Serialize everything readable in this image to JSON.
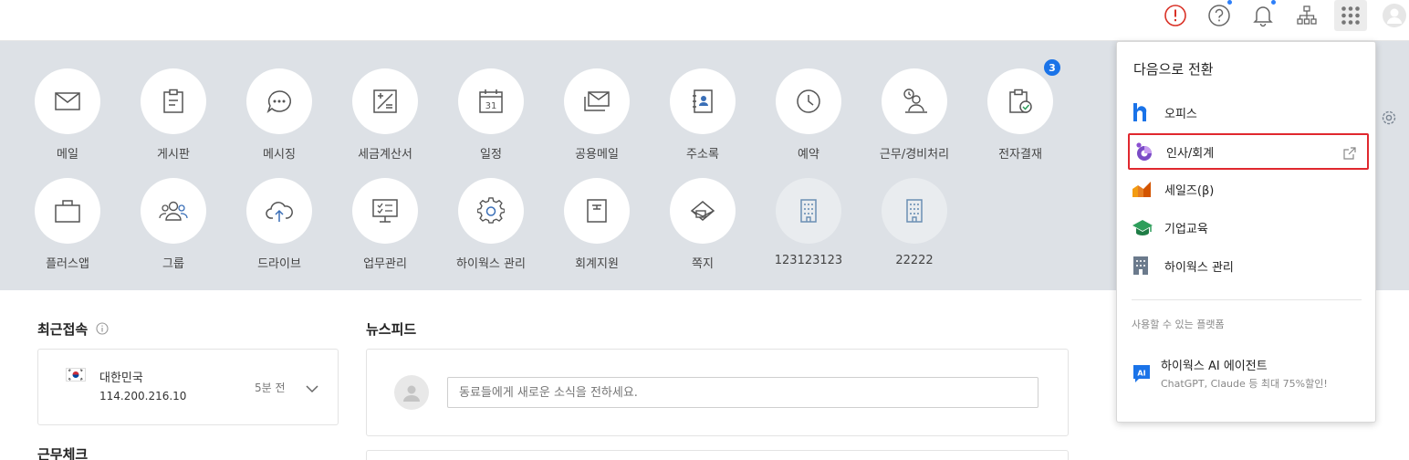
{
  "topbar": {
    "icons": [
      "alert-icon",
      "help-icon",
      "bell-icon",
      "org-chart-icon",
      "apps-grid-icon",
      "profile-icon"
    ]
  },
  "apps_row1": [
    {
      "label": "메일",
      "icon": "mail-icon"
    },
    {
      "label": "게시판",
      "icon": "board-icon"
    },
    {
      "label": "메시징",
      "icon": "chat-icon"
    },
    {
      "label": "세금계산서",
      "icon": "tax-invoice-icon"
    },
    {
      "label": "일정",
      "icon": "calendar-icon",
      "day": "31"
    },
    {
      "label": "공용메일",
      "icon": "shared-mail-icon"
    },
    {
      "label": "주소록",
      "icon": "address-book-icon"
    },
    {
      "label": "예약",
      "icon": "clock-icon"
    },
    {
      "label": "근무/경비처리",
      "icon": "work-expense-icon"
    },
    {
      "label": "전자결재",
      "icon": "approval-icon",
      "badge": "3"
    }
  ],
  "apps_row2": [
    {
      "label": "플러스앱",
      "icon": "bag-icon"
    },
    {
      "label": "그룹",
      "icon": "group-icon"
    },
    {
      "label": "드라이브",
      "icon": "cloud-icon"
    },
    {
      "label": "업무관리",
      "icon": "task-icon"
    },
    {
      "label": "하이웍스 관리",
      "icon": "gear-icon"
    },
    {
      "label": "회계지원",
      "icon": "accounting-icon"
    },
    {
      "label": "쪽지",
      "icon": "note-icon"
    },
    {
      "label": "123123123",
      "icon": "building-icon"
    },
    {
      "label": "22222",
      "icon": "building-icon"
    }
  ],
  "recent": {
    "title": "최근접속",
    "country": "대한민국",
    "ip": "114.200.216.10",
    "time": "5분 전"
  },
  "newsfeed": {
    "title": "뉴스피드",
    "placeholder": "동료들에게 새로운 소식을 전하세요."
  },
  "workcheck": {
    "title": "근무체크"
  },
  "dropdown": {
    "title": "다음으로 전환",
    "items": [
      {
        "label": "오피스",
        "icon": "hiworks-logo-icon"
      },
      {
        "label": "인사/회계",
        "icon": "hr-accounting-icon",
        "selected": true
      },
      {
        "label": "세일즈(β)",
        "icon": "sales-icon"
      },
      {
        "label": "기업교육",
        "icon": "education-cap-icon"
      },
      {
        "label": "하이웍스 관리",
        "icon": "building-icon"
      }
    ],
    "platforms_title": "사용할 수 있는 플랫폼",
    "ai": {
      "title": "하이웍스 AI 에이전트",
      "subtitle": "ChatGPT, Claude 등 최대 75%할인!",
      "icon_text": "AI"
    }
  },
  "colors": {
    "accent": "#1a73e8",
    "selected_border": "#e0282e",
    "band": "#dde1e6",
    "icon_gray": "#555555"
  }
}
